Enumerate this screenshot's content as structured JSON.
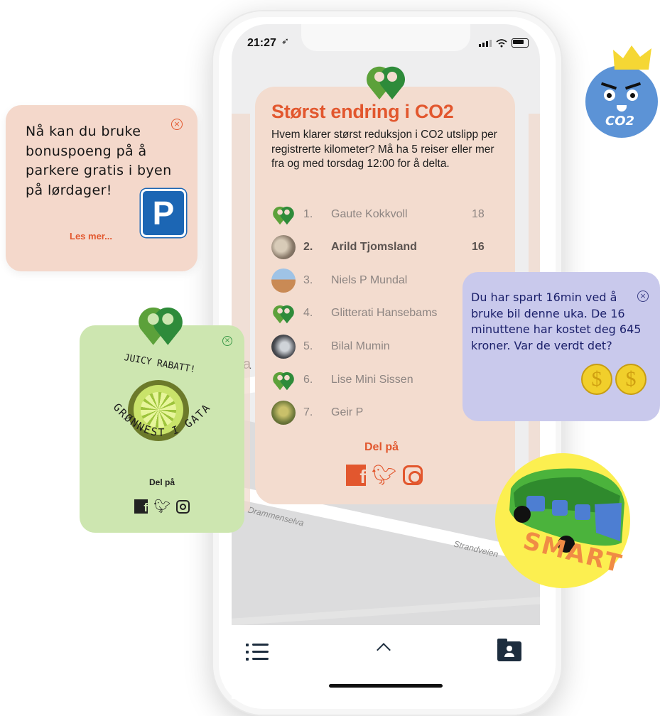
{
  "status_bar": {
    "time": "21:27"
  },
  "leaderboard": {
    "title": "Størst endring i CO2",
    "description": "Hvem klarer størst reduksjon i CO2 utslipp per registrerte kilometer? Må ha 5 reiser eller mer fra og med torsdag 12:00 for å delta.",
    "entries": [
      {
        "rank": "1.",
        "name": "Gaute Kokkvoll",
        "score": "18",
        "avatar": "logo"
      },
      {
        "rank": "2.",
        "name": "Arild Tjomsland",
        "score": "16",
        "avatar": "photo"
      },
      {
        "rank": "3.",
        "name": "Niels P Mundal",
        "score": "",
        "avatar": "photo"
      },
      {
        "rank": "4.",
        "name": "Glitterati Hansebams",
        "score": "",
        "avatar": "logo"
      },
      {
        "rank": "5.",
        "name": "Bilal Mumin",
        "score": "",
        "avatar": "photo"
      },
      {
        "rank": "6.",
        "name": "Lise Mini Sissen",
        "score": "",
        "avatar": "logo"
      },
      {
        "rank": "7.",
        "name": "Geir P",
        "score": "",
        "avatar": "photo"
      }
    ],
    "share_label": "Del på",
    "accent_color": "#e2572e"
  },
  "map": {
    "labels": {
      "river": "Drammenselva",
      "road": "Strandveien",
      "letter_a": "a"
    }
  },
  "parking_card": {
    "text": "Nå kan du bruke bonuspoeng på å parkere gratis i byen på lørdager!",
    "sign": "P",
    "link": "Les mer..."
  },
  "green_card": {
    "arc_top": "JUICY RABATT!",
    "arc_bottom": "GRØNNEST I GATA",
    "share_label": "Del på"
  },
  "time_card": {
    "text": "Du har spart 16min ved å bruke bil denne uka. De 16 minuttene har kostet deg 645 kroner. Var de verdt det?",
    "coin_symbol": "$"
  },
  "stickers": {
    "co2": "CO2",
    "smart": "SMART"
  },
  "icons": {
    "close": "close-icon",
    "menu": "menu-icon",
    "chevron_up": "chevron-up-icon",
    "profile": "profile-folder-icon",
    "facebook": "facebook-icon",
    "twitter": "twitter-icon",
    "instagram": "instagram-icon"
  }
}
